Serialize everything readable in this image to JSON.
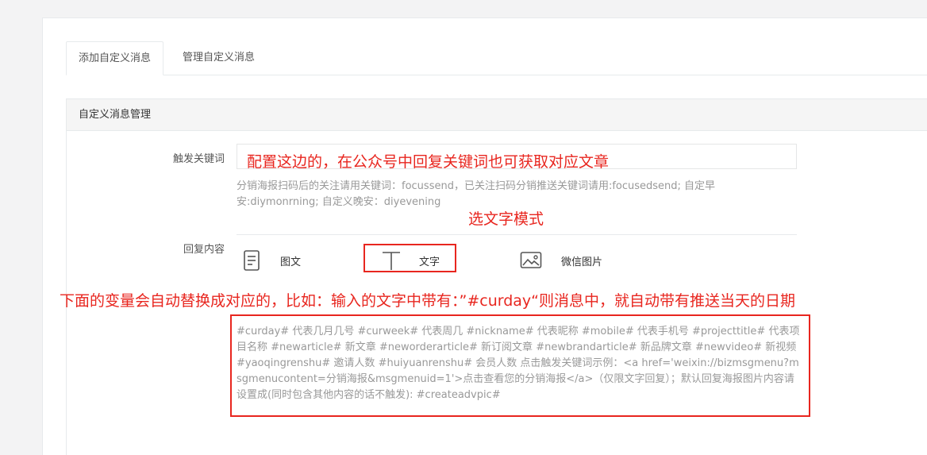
{
  "tabs": [
    {
      "label": "添加自定义消息",
      "active": true
    },
    {
      "label": "管理自定义消息",
      "active": false
    }
  ],
  "box": {
    "title": "自定义消息管理"
  },
  "form": {
    "keyword_label": "触发关键词",
    "keyword_value": "",
    "keyword_help": "分销海报扫码后的关注请用关键词：focussend，已关注扫码分销推送关键词请用:focusedsend; 自定早安:diymonrning; 自定义晚安：diyevening",
    "reply_label": "回复内容",
    "reply_options": [
      {
        "label": "图文",
        "icon": "document-icon"
      },
      {
        "label": "文字",
        "icon": "text-icon",
        "selected": true
      },
      {
        "label": "微信图片",
        "icon": "image-icon"
      }
    ],
    "textarea_placeholder": "#curday# 代表几月几号 #curweek# 代表周几 #nickname# 代表昵称 #mobile# 代表手机号 #projecttitle# 代表项目名称 #newarticle# 新文章 #neworderarticle# 新订阅文章 #newbrandarticle# 新品牌文章 #newvideo# 新视频 #yaoqingrenshu# 邀请人数 #huiyuanrenshu# 会员人数 点击触发关键词示例：<a href='weixin://bizmsgmenu?msgmenucontent=分销海报&msgmenuid=1'>点击查看您的分销海报</a>（仅限文字回复）；默认回复海报图片内容请设置成(同时包含其他内容的话不触发): #createadvpic#"
  },
  "annotations": {
    "keyword_note": "配置这边的，在公众号中回复关键词也可获取对应文章",
    "mode_note": "选文字模式",
    "variable_note": "下面的变量会自动替换成对应的，比如：输入的文字中带有：”#curday“则消息中，就自动带有推送当天的日期"
  },
  "colors": {
    "annotation": "#e8261f",
    "border": "#e7eaec"
  }
}
